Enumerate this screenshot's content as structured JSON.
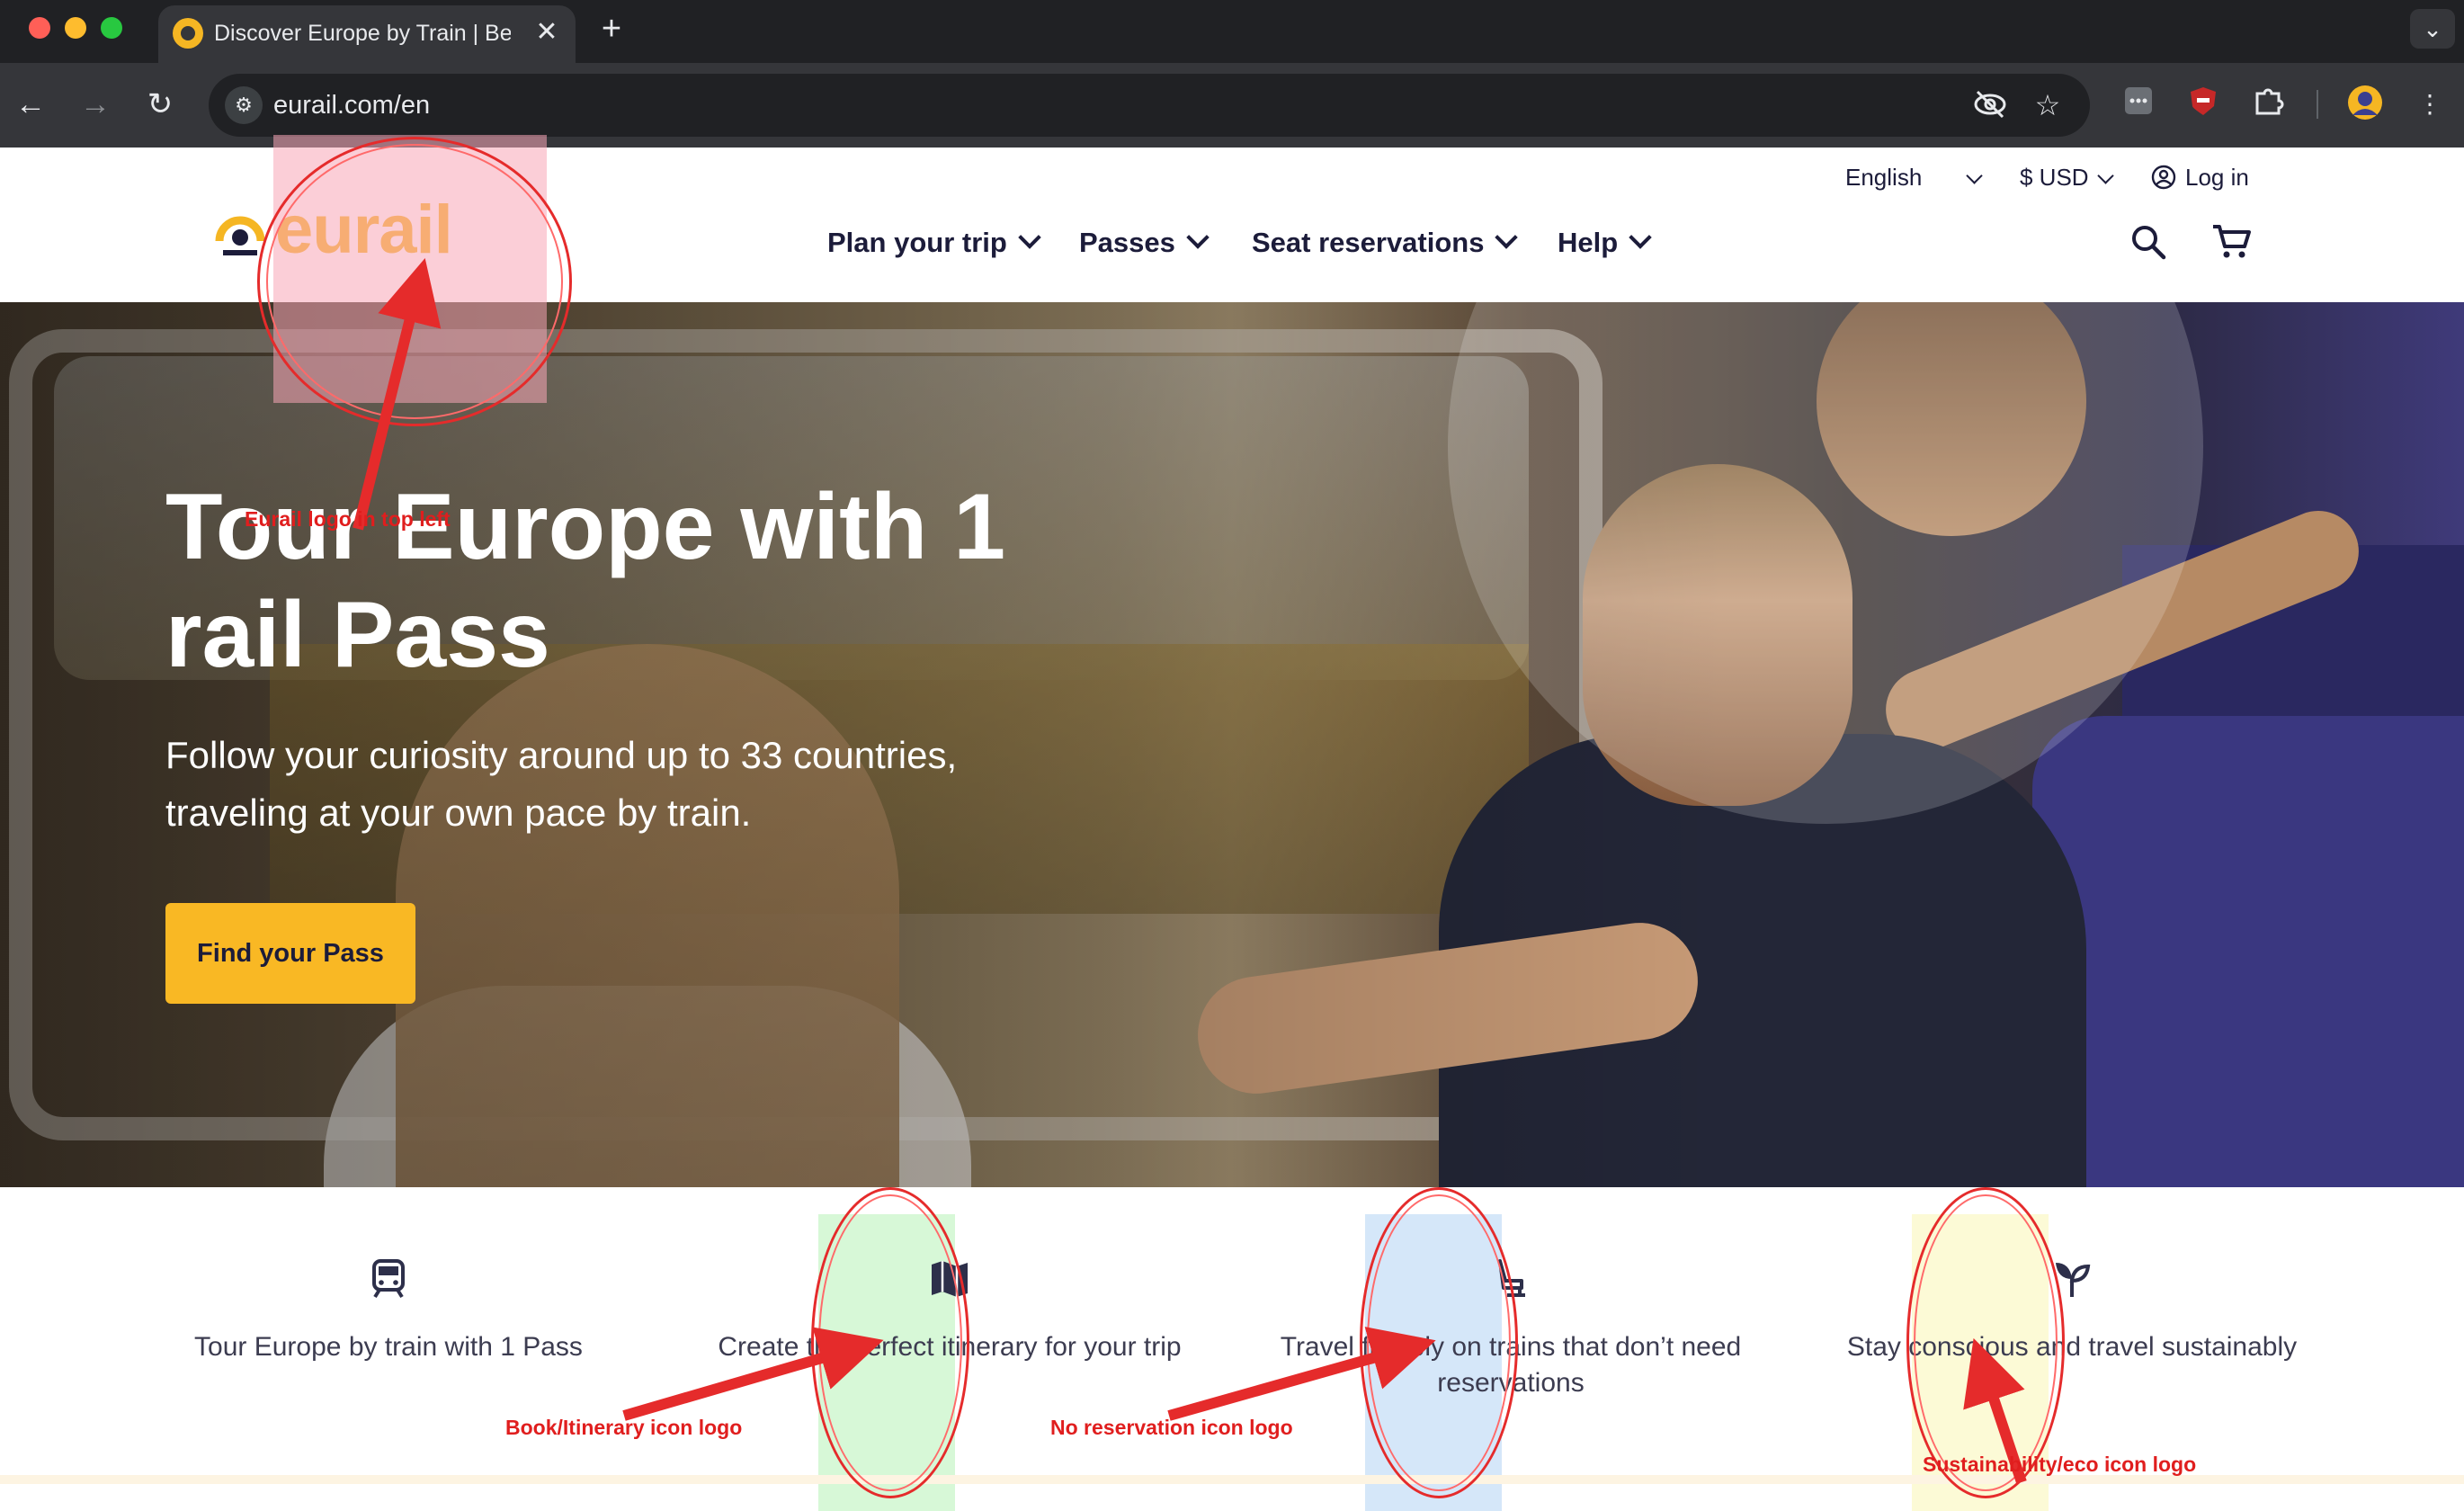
{
  "browser": {
    "tab_title": "Discover Europe by Train | Be",
    "close_glyph": "✕",
    "new_tab_glyph": "+",
    "tab_menu_glyph": "⌄",
    "url": "eurail.com/en",
    "back_glyph": "←",
    "forward_glyph": "→",
    "reload_glyph": "↻",
    "more_glyph": "⋮"
  },
  "header": {
    "logo_text": "eurail",
    "language": "English",
    "currency": "$ USD",
    "login": "Log in",
    "nav": [
      {
        "label": "Plan your trip"
      },
      {
        "label": "Passes"
      },
      {
        "label": "Seat reservations"
      },
      {
        "label": "Help"
      }
    ]
  },
  "hero": {
    "title": "Tour Europe with 1 rail Pass",
    "subtitle": "Follow your curiosity around up to 33 countries, traveling at your own pace by train.",
    "cta": "Find your Pass"
  },
  "features": [
    {
      "text": "Tour Europe by train with 1 Pass",
      "icon": "train-icon"
    },
    {
      "text": "Create the perfect itinerary for your trip",
      "icon": "map-book-icon"
    },
    {
      "text": "Travel flexibly on trains that don’t need reservations",
      "icon": "seat-icon"
    },
    {
      "text": "Stay conscious and travel sustainably",
      "icon": "leaf-icon"
    }
  ],
  "annotations": [
    {
      "label": "Eurail logo in top left",
      "color": "#e01e1e"
    },
    {
      "label": "Book/Itinerary icon logo",
      "color": "#e01e1e"
    },
    {
      "label": "No reservation icon logo",
      "color": "#e01e1e"
    },
    {
      "label": "Sustainability/eco icon logo",
      "color": "#e01e1e"
    }
  ],
  "colors": {
    "brand_yellow": "#f9b824",
    "navy": "#1c1c3a",
    "annotation_red": "#e52b2b",
    "highlight_pink": "#f7a6b6",
    "highlight_green": "#c9f5c9",
    "highlight_blue": "#c7dff7",
    "highlight_yellow": "#fbf9cf"
  }
}
